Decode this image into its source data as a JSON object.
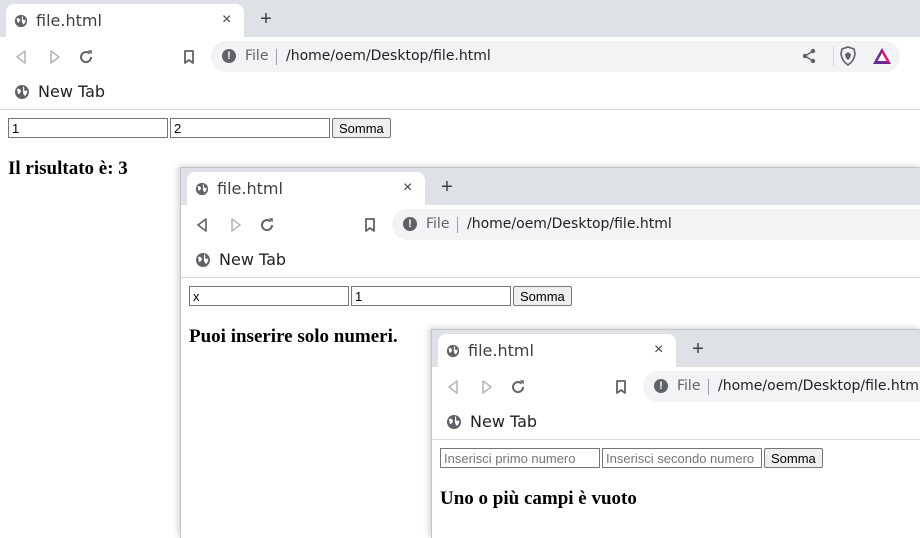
{
  "browser": {
    "tab_title": "file.html",
    "close_symbol": "×",
    "newtab_symbol": "+",
    "omnibox": {
      "scheme_label": "File",
      "url": "/home/oem/Desktop/file.html",
      "info_symbol": "!"
    },
    "bookmark": {
      "label": "New Tab",
      "icon": "globe-icon"
    }
  },
  "windows": [
    {
      "input1": {
        "value": "1",
        "placeholder": ""
      },
      "input2": {
        "value": "2",
        "placeholder": ""
      },
      "button": "Somma",
      "result": "Il risultato è: 3"
    },
    {
      "input1": {
        "value": "x",
        "placeholder": ""
      },
      "input2": {
        "value": "1",
        "placeholder": ""
      },
      "button": "Somma",
      "result": "Puoi inserire solo numeri."
    },
    {
      "input1": {
        "value": "",
        "placeholder": "Inserisci primo numero"
      },
      "input2": {
        "value": "",
        "placeholder": "Inserisci secondo numero"
      },
      "button": "Somma",
      "result": "Uno o più campi è vuoto"
    }
  ],
  "colors": {
    "tabstrip": "#dee1e6",
    "omnibox": "#f1f3f4",
    "brave_orange": "#fb542b",
    "bat_red": "#e3146f",
    "bat_purple": "#662d91"
  }
}
